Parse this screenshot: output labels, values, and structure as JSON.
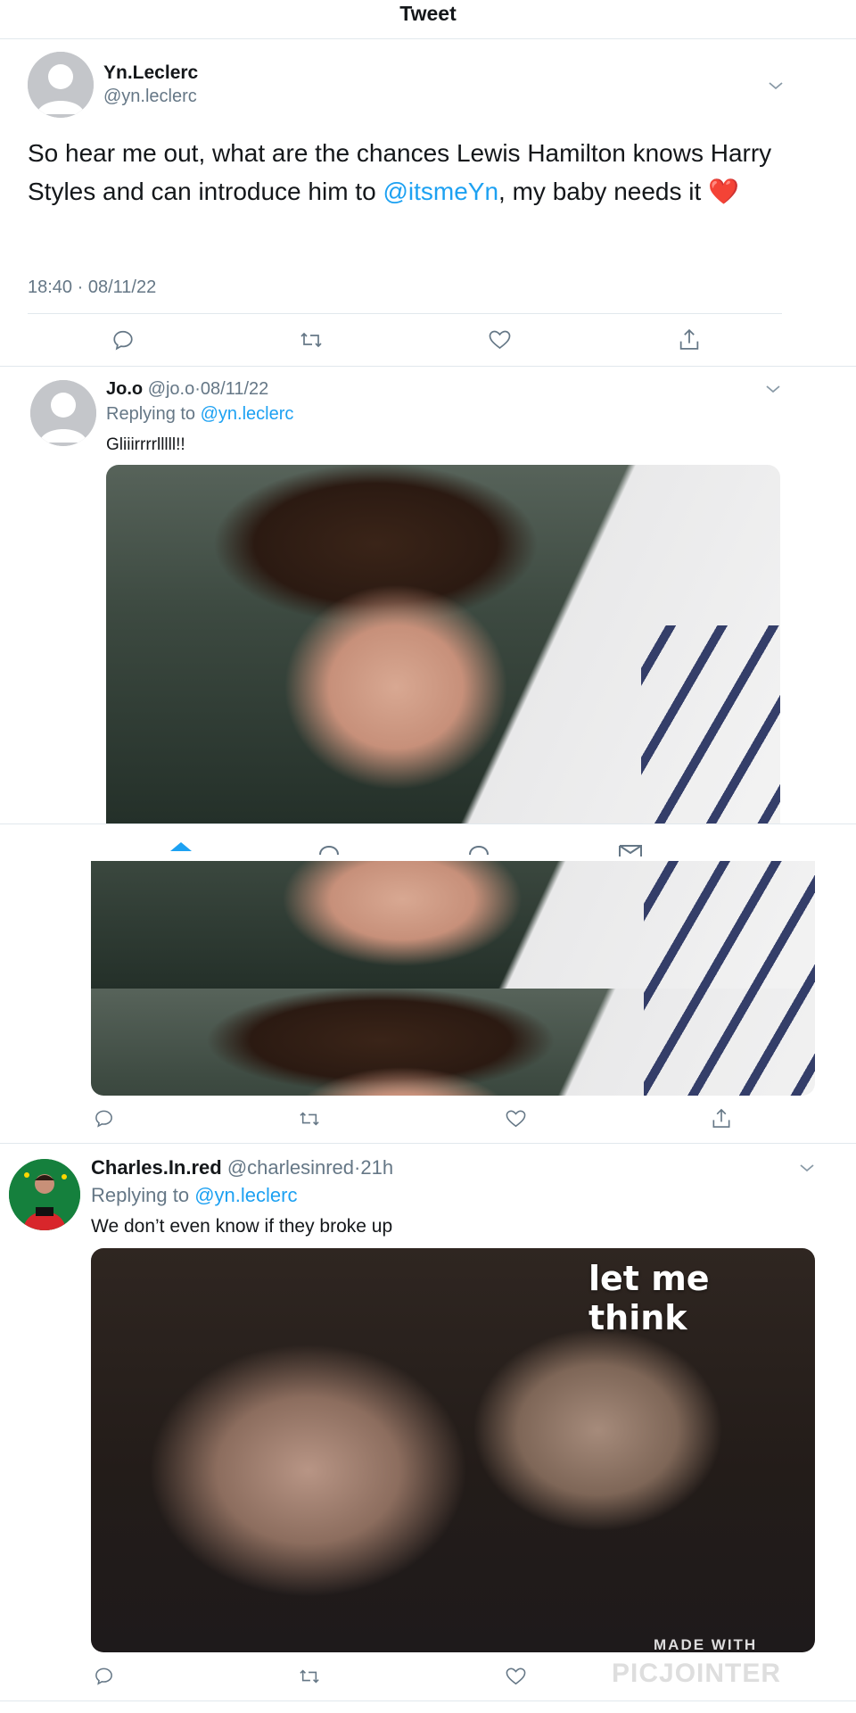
{
  "header": {
    "title": "Tweet"
  },
  "main_tweet": {
    "display_name": "Yn.Leclerc",
    "handle": "@yn.leclerc",
    "text_before": "So hear me out, what are the chances Lewis Hamilton knows Harry Styles and can introduce him to ",
    "mention": "@itsmeYn",
    "text_after": ", my baby needs it ",
    "emoji": "❤️",
    "timestamp": "18:40 · 08/11/22"
  },
  "reply1": {
    "display_name": "Jo.o",
    "handle": "@jo.o",
    "sep": "·",
    "date": "08/11/22",
    "replying_prefix": "Replying to ",
    "replying_to": "@yn.leclerc",
    "text": "Gliiirrrrlllll!!"
  },
  "reply2": {
    "display_name": "Charles.In.red",
    "handle": "@charlesinred",
    "sep": "·",
    "date": "21h",
    "replying_prefix": "Replying to ",
    "replying_to": "@yn.leclerc",
    "text": "We don’t even know if they broke up",
    "media_caption": "let me think"
  },
  "watermark": {
    "line1": "MADE WITH",
    "line2": "PICJOINTER"
  },
  "colors": {
    "link": "#1da1f2",
    "muted": "#657786",
    "divider": "#e1e8ed",
    "heart": "#e0245e"
  }
}
